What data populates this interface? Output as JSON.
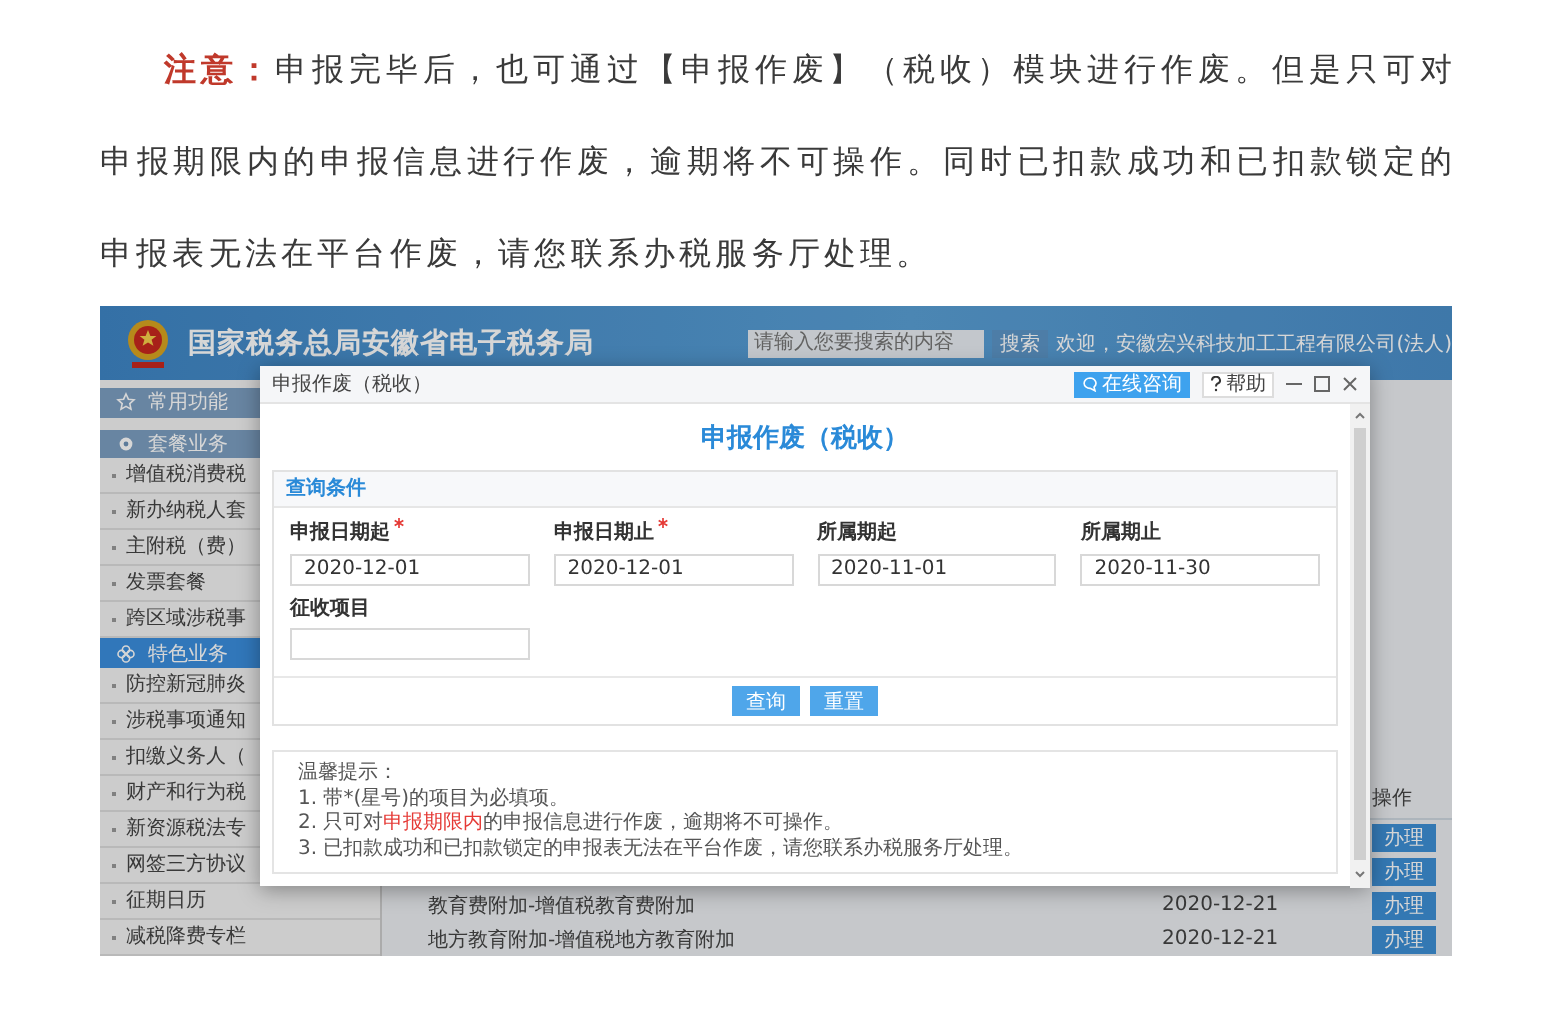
{
  "article": {
    "note_label": "注意：",
    "text": "申报完毕后，也可通过【申报作废】（税收）模块进行作废。但是只可对申报期限内的申报信息进行作废，逾期将不可操作。同时已扣款成功和已扣款锁定的申报表无法在平台作废，请您联系办税服务厅处理。"
  },
  "portal": {
    "title": "国家税务总局安徽省电子税务局",
    "search": {
      "placeholder": "请输入您要搜索的内容"
    },
    "search_button": "搜索",
    "welcome": "欢迎，安徽宏兴科技加工工程有限公司(法人)",
    "sidebar": [
      {
        "kind": "group",
        "label": "常用功能",
        "selected": false
      },
      {
        "kind": "spacer"
      },
      {
        "kind": "group",
        "label": "套餐业务",
        "selected": false
      },
      {
        "kind": "link",
        "label": "增值税消费税"
      },
      {
        "kind": "link",
        "label": "新办纳税人套"
      },
      {
        "kind": "link",
        "label": "主附税（费）"
      },
      {
        "kind": "link",
        "label": "发票套餐"
      },
      {
        "kind": "link",
        "label": "跨区域涉税事"
      },
      {
        "kind": "group",
        "label": "特色业务",
        "selected": true
      },
      {
        "kind": "link",
        "label": "防控新冠肺炎"
      },
      {
        "kind": "link",
        "label": "涉税事项通知"
      },
      {
        "kind": "link",
        "label": "扣缴义务人（"
      },
      {
        "kind": "link",
        "label": "财产和行为税"
      },
      {
        "kind": "link",
        "label": "新资源税法专"
      },
      {
        "kind": "link",
        "label": "网签三方协议"
      },
      {
        "kind": "link",
        "label": "征期日历"
      },
      {
        "kind": "link",
        "label": "减税降费专栏"
      }
    ],
    "table": {
      "columns": [
        {
          "label": "操作"
        }
      ],
      "rows": [
        {
          "action": "办理"
        },
        {
          "action": "办理"
        },
        {
          "item": "教育费附加-增值税教育费附加",
          "date": "2020-12-21",
          "action": "办理"
        },
        {
          "item": "地方教育附加-增值税地方教育附加",
          "date": "2020-12-21",
          "action": "办理"
        }
      ]
    }
  },
  "dialog": {
    "title": "申报作废（税收）",
    "consult_button": "在线咨询",
    "help_button": "帮助",
    "heading": "申报作废（税收）",
    "panel_title": "查询条件",
    "fields": [
      {
        "label": "申报日期起",
        "required": true,
        "value": "2020-12-01"
      },
      {
        "label": "申报日期止",
        "required": true,
        "value": "2020-12-01"
      },
      {
        "label": "所属期起",
        "required": false,
        "value": "2020-11-01"
      },
      {
        "label": "所属期止",
        "required": false,
        "value": "2020-11-30"
      },
      {
        "label": "征收项目",
        "required": false
      }
    ],
    "buttons": [
      "查询",
      "重置"
    ],
    "tips": {
      "title": "温馨提示：",
      "lines": [
        "1. 带*(星号)的项目为必填项。",
        "2. 只可对**申报期限内**的申报信息进行作废，逾期将不可操作。",
        "3. 已扣款成功和已扣款锁定的申报表无法在平台作废，请您联系办税服务厅处理。"
      ]
    }
  }
}
